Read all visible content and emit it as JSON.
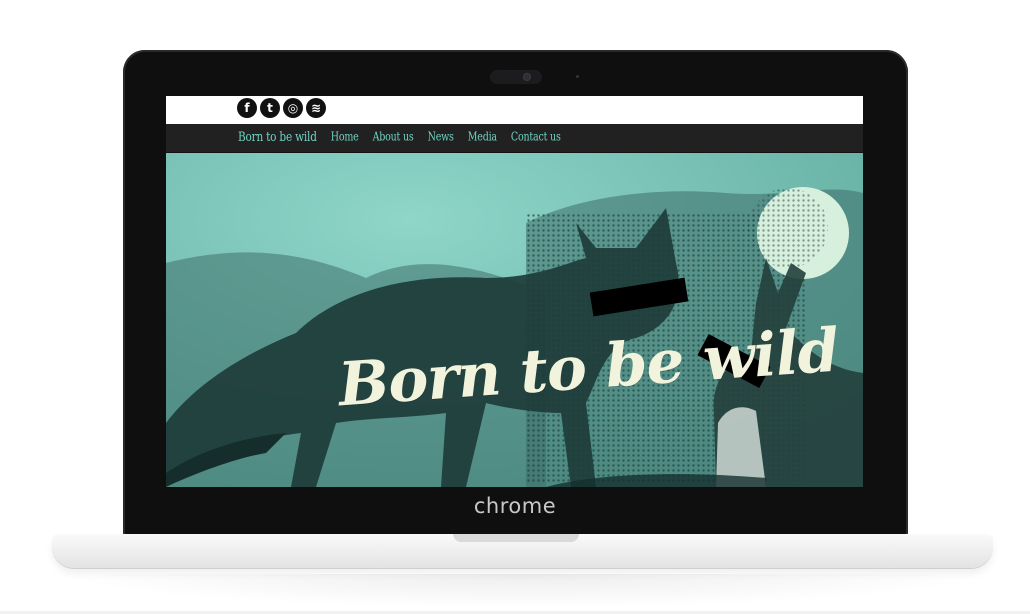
{
  "device": {
    "brand_label": "chrome"
  },
  "site": {
    "social_icons": [
      "facebook-icon",
      "twitter-icon",
      "instagram-icon",
      "spotify-icon"
    ],
    "social_glyphs": {
      "facebook": "f",
      "twitter": "t",
      "instagram": "◎",
      "spotify": "≋"
    },
    "nav": {
      "logo": "Born to be wild",
      "items": [
        "Home",
        "About us",
        "News",
        "Media",
        "Contact us"
      ]
    },
    "hero": {
      "title": "Born to be wild"
    },
    "colors": {
      "nav_text": "#6ed3c2",
      "nav_bg": "#212121",
      "hero_bg": "#7ac5b8",
      "hero_title": "#f2f3dc"
    }
  }
}
